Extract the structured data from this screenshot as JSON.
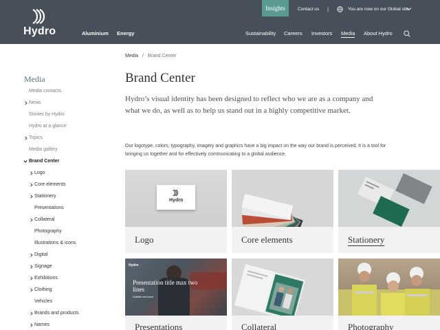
{
  "header": {
    "logo_text": "Hydro",
    "nav_left": [
      "Aluminium",
      "Energy"
    ],
    "insights": "Insights",
    "contact": "Contact us",
    "separator": "|",
    "global_site": "You are now on our Global site",
    "nav_right": [
      "Sustainability",
      "Careers",
      "Investors",
      "Media",
      "About Hydro"
    ],
    "active_nav": "Media"
  },
  "breadcrumb": {
    "root": "Media",
    "separator": "/",
    "current": "Brand Center"
  },
  "sidebar": {
    "title": "Media",
    "items": [
      {
        "label": "Media contacts"
      },
      {
        "label": "News"
      },
      {
        "label": "Stories by Hydro"
      },
      {
        "label": "Hydro at a glance"
      },
      {
        "label": "Topics"
      },
      {
        "label": "Media gallery"
      },
      {
        "label": "Brand Center"
      },
      {
        "label": "Logo"
      },
      {
        "label": "Core elements"
      },
      {
        "label": "Stationery"
      },
      {
        "label": "Presentations"
      },
      {
        "label": "Collateral"
      },
      {
        "label": "Photography"
      },
      {
        "label": "Illustrations & icons"
      },
      {
        "label": "Digital"
      },
      {
        "label": "Signage"
      },
      {
        "label": "Exhibitions"
      },
      {
        "label": "Clothing"
      },
      {
        "label": "Vehicles"
      },
      {
        "label": "Brands and products"
      },
      {
        "label": "Names"
      }
    ]
  },
  "main": {
    "title": "Brand Center",
    "intro": "Hydro’s visual identity has been designed to reflect who we are as a company and what we do, as well as to help us stand out in a highly competitive market.",
    "body": "Our logotype, colors, typography, imagery and graphics have a big impact on the way our brand is perceived. It is a tool for bringing us together and for effectively communicating to a global audience.",
    "cards": [
      {
        "label": "Logo"
      },
      {
        "label": "Core elements"
      },
      {
        "label": "Stationery"
      },
      {
        "label": "Presentations",
        "overlay_logo": "Hydro",
        "overlay_title": "Presentation title max two lines",
        "overlay_sub": "Subtitle text here"
      },
      {
        "label": "Collateral"
      },
      {
        "label": "Photography"
      }
    ],
    "card_images": {
      "logo_card_text": "Hydro"
    }
  },
  "colors": {
    "header_bg": "#47505a",
    "insights_bg": "#5a9a93",
    "sidebar_title": "#5f7480"
  }
}
